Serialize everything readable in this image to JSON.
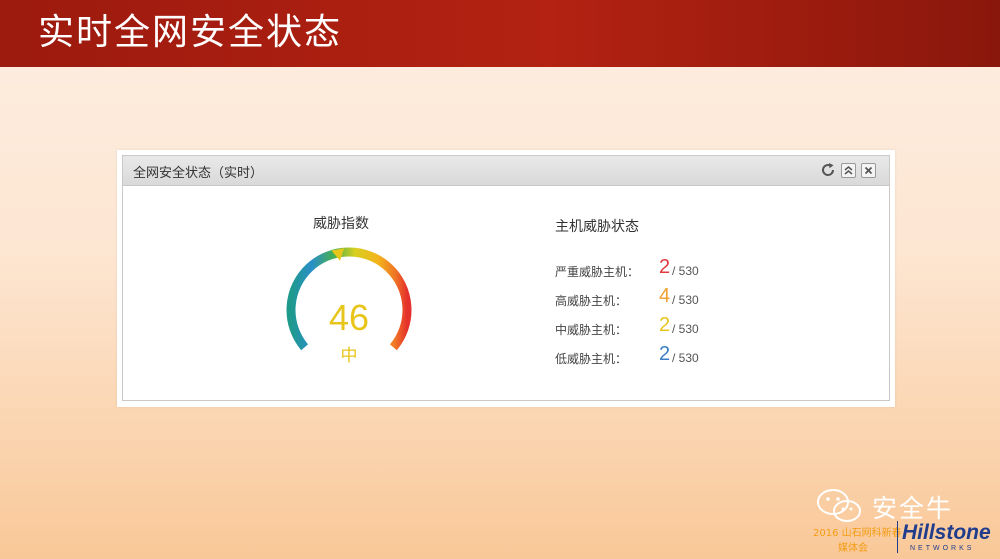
{
  "slide": {
    "title": "实时全网安全状态"
  },
  "widget": {
    "title": "全网安全状态（实时）",
    "buttons": {
      "refresh_icon": "refresh-icon",
      "collapse_icon": "double-chevron-up-icon",
      "close_icon": "close-icon"
    }
  },
  "threat_index": {
    "title": "威胁指数",
    "value": "46",
    "level": "中",
    "value_number": 46,
    "max": 100,
    "color": "#e8c51a"
  },
  "host_status": {
    "title": "主机威胁状态",
    "rows": [
      {
        "label": "严重威胁主机：",
        "count": "2",
        "total": "/ 530",
        "color": "#e0393e"
      },
      {
        "label": "高威胁主机：",
        "count": "4",
        "total": "/ 530",
        "color": "#f0a030"
      },
      {
        "label": "中威胁主机：",
        "count": "2",
        "total": "/ 530",
        "color": "#e8c51a"
      },
      {
        "label": "低威胁主机：",
        "count": "2",
        "total": "/ 530",
        "color": "#3a7ec6"
      }
    ]
  },
  "watermark": {
    "account": "安全牛",
    "event_line1": "2016 山石网科新春",
    "event_line2": "媒体会",
    "brand": "Hillstone",
    "brand_sub": "NETWORKS"
  }
}
